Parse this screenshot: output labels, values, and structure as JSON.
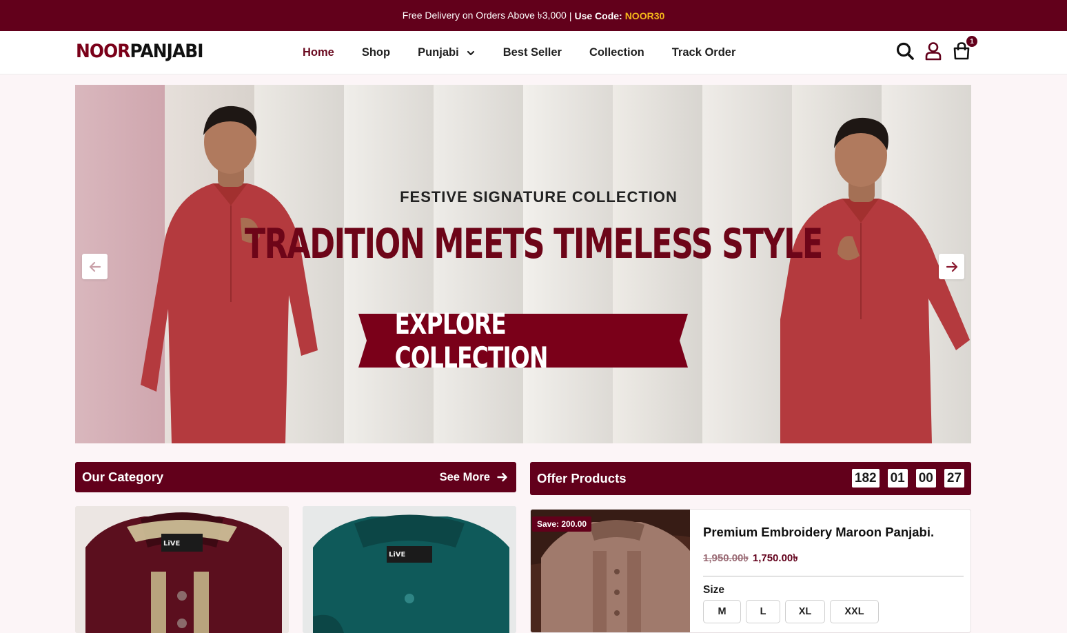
{
  "announcement": {
    "text": "Free Delivery on Orders Above ৳3,000",
    "separator": "|",
    "code_label": "Use Code:",
    "code": "NOOR30"
  },
  "header": {
    "logo_part1": "NOOR",
    "logo_part2": "PANJABI",
    "nav": [
      {
        "label": "Home",
        "active": true
      },
      {
        "label": "Shop"
      },
      {
        "label": "Punjabi",
        "has_dropdown": true
      },
      {
        "label": "Best Seller"
      },
      {
        "label": "Collection"
      },
      {
        "label": "Track Order"
      }
    ],
    "icons": [
      "search-icon",
      "user-icon",
      "cart-icon"
    ],
    "cart_count": "1"
  },
  "hero": {
    "subtitle": "FESTIVE SIGNATURE COLLECTION",
    "title": "TRADITION MEETS TIMELESS STYLE",
    "button_label": "EXPLORE COLLECTION",
    "accent_color": "#7a0019"
  },
  "category": {
    "title": "Our Category",
    "see_more": "See More",
    "cards": [
      {
        "color": "#5b0f1e",
        "logo": "LiVE"
      },
      {
        "color": "#0f5a5a",
        "logo": "LiVE"
      }
    ]
  },
  "offer": {
    "title": "Offer Products",
    "timer": [
      "182",
      "01",
      "00",
      "27"
    ],
    "product": {
      "save_badge": "Save: 200.00",
      "name": "Premium Embroidery Maroon Panjabi.",
      "old_price": "1,950.00৳",
      "new_price": "1,750.00৳",
      "size_label": "Size",
      "sizes": [
        "M",
        "L",
        "XL",
        "XXL"
      ]
    }
  },
  "colors": {
    "brand": "#62001b",
    "timer_bg": "#ffffff",
    "promo_code": "#f5b81a"
  }
}
